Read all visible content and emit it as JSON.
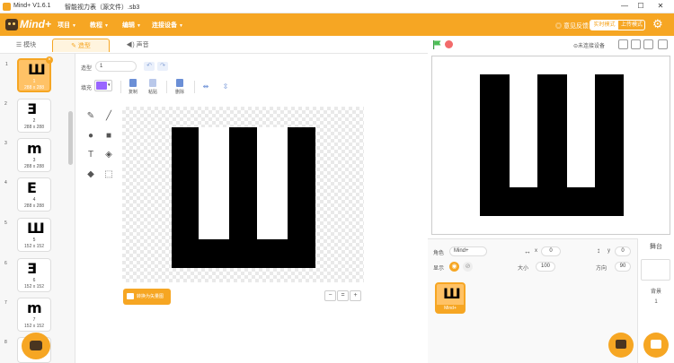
{
  "window": {
    "app_title": "Mind+ V1.6.1",
    "doc_title": "智能视力表（源文件）.sb3",
    "buttons": {
      "min": "—",
      "max": "☐",
      "close": "✕"
    }
  },
  "menubar": {
    "logo": "Mind+",
    "items": [
      "项目",
      "教程",
      "编辑",
      "连接设备"
    ],
    "feedback": "意见反馈",
    "mode_realtime": "实时模式",
    "mode_upload": "上传模式",
    "settings_icon": "gear-icon"
  },
  "tabs": {
    "blocks": "模块",
    "costumes": "造型",
    "sounds": "声音"
  },
  "stage_bar": {
    "connect_status": "未连接设备"
  },
  "costumes": [
    {
      "index": "1",
      "glyph": "Ш",
      "name": "1",
      "size": "288 x 288",
      "selected": true
    },
    {
      "index": "2",
      "glyph": "Ǝ",
      "name": "2",
      "size": "288 x 288",
      "selected": false
    },
    {
      "index": "3",
      "glyph": "m",
      "name": "3",
      "size": "288 x 288",
      "selected": false
    },
    {
      "index": "4",
      "glyph": "E",
      "name": "4",
      "size": "288 x 288",
      "selected": false
    },
    {
      "index": "5",
      "glyph": "Ш",
      "name": "5",
      "size": "152 x 152",
      "selected": false
    },
    {
      "index": "6",
      "glyph": "Ǝ",
      "name": "6",
      "size": "152 x 152",
      "selected": false
    },
    {
      "index": "7",
      "glyph": "m",
      "name": "7",
      "size": "152 x 152",
      "selected": false
    },
    {
      "index": "8",
      "glyph": "",
      "name": "",
      "size": "",
      "selected": false
    }
  ],
  "editor": {
    "costume_label": "造型",
    "costume_name": "1",
    "fill_label": "填充",
    "fill_color": "#9966ff",
    "copy": "复制",
    "paste": "粘贴",
    "delete": "删除",
    "convert": "转换为矢量图"
  },
  "sprite_info": {
    "sprite_label": "角色",
    "sprite_name": "Mind+",
    "x_label": "x",
    "x_value": "0",
    "y_label": "y",
    "y_value": "0",
    "show_label": "显示",
    "size_label": "大小",
    "size_value": "100",
    "direction_label": "方向",
    "direction_value": "90"
  },
  "sprites": [
    {
      "name": "Mind+"
    }
  ],
  "stage_panel": {
    "title": "舞台",
    "backdrop_label": "背景",
    "backdrop_count": "1"
  },
  "colors": {
    "accent": "#f6a623",
    "fill": "#9966ff",
    "stop": "#f26b6b",
    "flag": "#4cbf56"
  }
}
